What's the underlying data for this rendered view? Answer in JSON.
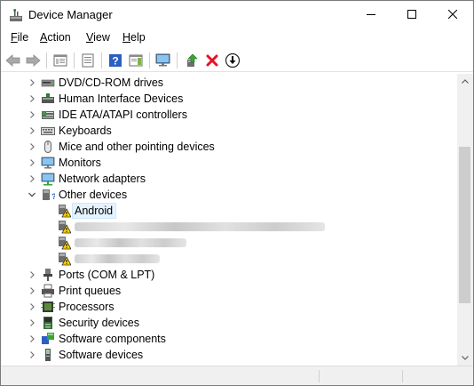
{
  "window": {
    "title": "Device Manager",
    "minimize_glyph": "—",
    "maximize_glyph": "☐",
    "close_glyph": "✕"
  },
  "menu": {
    "items": [
      {
        "label": "File",
        "underline": "F",
        "rest": "ile"
      },
      {
        "label": "Action",
        "underline": "A",
        "rest": "ction"
      },
      {
        "label": "View",
        "underline": "V",
        "rest": "iew"
      },
      {
        "label": "Help",
        "underline": "H",
        "rest": "elp"
      }
    ]
  },
  "toolbar": {
    "buttons": [
      {
        "name": "back-button",
        "icon": "arrow-left-icon"
      },
      {
        "name": "forward-button",
        "icon": "arrow-right-icon"
      },
      {
        "name": "show-hide-console-tree-button",
        "icon": "console-tree-icon"
      },
      {
        "name": "properties-button",
        "icon": "properties-icon"
      },
      {
        "name": "help-button",
        "icon": "help-icon"
      },
      {
        "name": "show-action-pane-button",
        "icon": "action-pane-icon"
      },
      {
        "name": "scan-hardware-button",
        "icon": "monitor-scan-icon"
      },
      {
        "name": "update-driver-button",
        "icon": "update-driver-icon"
      },
      {
        "name": "uninstall-device-button",
        "icon": "red-x-icon"
      },
      {
        "name": "disable-device-button",
        "icon": "down-arrow-circle-icon"
      }
    ]
  },
  "tree": {
    "rows": [
      {
        "label": "DVD/CD-ROM drives",
        "icon": "dvd-drive-icon",
        "expanded": false,
        "level": 0
      },
      {
        "label": "Human Interface Devices",
        "icon": "hid-icon",
        "expanded": false,
        "level": 0
      },
      {
        "label": "IDE ATA/ATAPI controllers",
        "icon": "ide-controller-icon",
        "expanded": false,
        "level": 0
      },
      {
        "label": "Keyboards",
        "icon": "keyboard-icon",
        "expanded": false,
        "level": 0
      },
      {
        "label": "Mice and other pointing devices",
        "icon": "mouse-icon",
        "expanded": false,
        "level": 0
      },
      {
        "label": "Monitors",
        "icon": "monitor-icon",
        "expanded": false,
        "level": 0
      },
      {
        "label": "Network adapters",
        "icon": "network-adapter-icon",
        "expanded": false,
        "level": 0
      },
      {
        "label": "Other devices",
        "icon": "other-devices-icon",
        "expanded": true,
        "level": 0
      },
      {
        "label": "Android",
        "icon": "warning-device-icon",
        "level": 1,
        "selected": true
      },
      {
        "label": "",
        "icon": "warning-device-icon",
        "level": 1,
        "redacted": true
      },
      {
        "label": "",
        "icon": "warning-device-icon",
        "level": 1,
        "redacted": true
      },
      {
        "label": "",
        "icon": "warning-device-icon",
        "level": 1,
        "redacted": true
      },
      {
        "label": "Ports (COM & LPT)",
        "icon": "ports-icon",
        "expanded": false,
        "level": 0
      },
      {
        "label": "Print queues",
        "icon": "printer-icon",
        "expanded": false,
        "level": 0
      },
      {
        "label": "Processors",
        "icon": "processor-icon",
        "expanded": false,
        "level": 0
      },
      {
        "label": "Security devices",
        "icon": "security-device-icon",
        "expanded": false,
        "level": 0
      },
      {
        "label": "Software components",
        "icon": "software-component-icon",
        "expanded": false,
        "level": 0
      },
      {
        "label": "Software devices",
        "icon": "software-device-icon",
        "expanded": false,
        "level": 0
      }
    ]
  },
  "colors": {
    "selection_bg": "#e5f3ff",
    "selection_border": "#cce8ff",
    "warning_yellow": "#ffd100",
    "delete_red": "#e81123",
    "help_blue": "#2b5fc1"
  }
}
